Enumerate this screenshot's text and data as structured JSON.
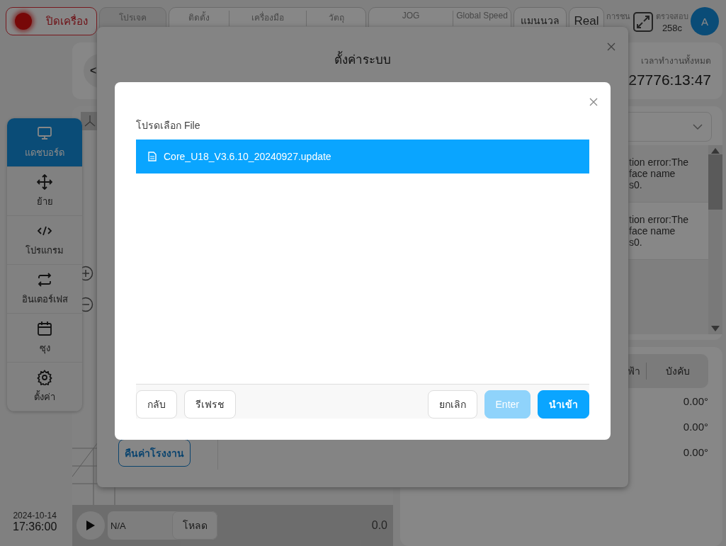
{
  "header": {
    "power_button": {
      "label": "ปิดเครื่อง"
    },
    "chips": [
      {
        "kind": "single",
        "fields": [
          {
            "label": "โปรเจค"
          }
        ]
      },
      {
        "kind": "group",
        "fields": [
          {
            "label": "ติดตั้ง"
          },
          {
            "label": "เครื่องมือ"
          },
          {
            "label": "วัตถุ"
          }
        ]
      },
      {
        "kind": "group",
        "fields": [
          {
            "label": "JOG"
          },
          {
            "label": "Global Speed"
          }
        ]
      },
      {
        "kind": "mode",
        "fields": [
          {
            "label": "แมนนวล"
          }
        ]
      },
      {
        "kind": "mode",
        "fields": [
          {
            "label": "Real"
          }
        ]
      }
    ],
    "collision": {
      "label": "การชน"
    },
    "check": {
      "label": "ตรวจสอบ",
      "value": "258c"
    },
    "avatar": {
      "initial": "A"
    }
  },
  "sidebar": {
    "items": [
      {
        "label": "แดชบอร์ด",
        "selected": true
      },
      {
        "label": "ย้าย",
        "selected": false
      },
      {
        "label": "โปรแกรม",
        "selected": false
      },
      {
        "label": "อินเตอร์เฟส",
        "selected": false
      },
      {
        "label": "ซุง",
        "selected": false
      },
      {
        "label": "ตั้งค่า",
        "selected": false
      }
    ]
  },
  "clock": {
    "date": "2024-10-14",
    "time": "17:36:00"
  },
  "back_button": {
    "label": "<"
  },
  "runtime": {
    "label": "เวลาทำงานทั้งหมด",
    "value": "27776:13:47"
  },
  "log": {
    "entries": [
      {
        "message": "tion error:The\nface name\ns0."
      },
      {
        "message": "tion error:The\nface name\ns0."
      }
    ]
  },
  "joints": {
    "tabs": [
      {
        "label": "ฟ้า"
      },
      {
        "label": "บังคับ"
      }
    ],
    "rows": [
      {
        "value": "0.00°"
      },
      {
        "value": "0.00°"
      },
      {
        "value": "0.00°"
      }
    ]
  },
  "player": {
    "program": "N/A",
    "load_button": "โหลด",
    "speed": "0.0"
  },
  "settings_dialog": {
    "title": "ตั้งค่าระบบ",
    "factory_reset": "คืนค่าโรงงาน"
  },
  "file_dialog": {
    "label": "โปรดเลือก File",
    "files": [
      {
        "name": "Core_U18_V3.6.10_20240927.update",
        "selected": true
      }
    ],
    "left_buttons": [
      {
        "label": "กลับ",
        "kind": "default",
        "disabled": false
      },
      {
        "label": "รีเฟรช",
        "kind": "default",
        "disabled": false
      }
    ],
    "right_buttons": [
      {
        "label": "ยกเลิก",
        "kind": "default",
        "disabled": false
      },
      {
        "label": "Enter",
        "kind": "primary",
        "disabled": true
      },
      {
        "label": "นำเข้า",
        "kind": "primary",
        "disabled": false
      }
    ]
  }
}
